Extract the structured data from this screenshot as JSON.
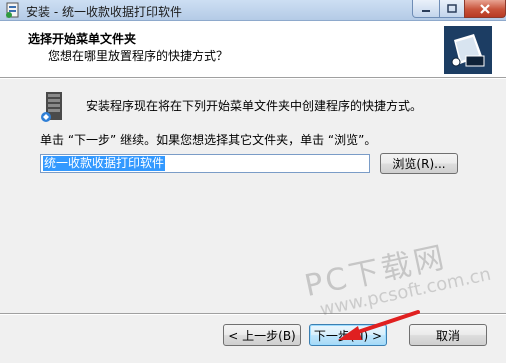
{
  "window": {
    "title": "安装 - 统一收款收据打印软件",
    "controls": {
      "minimize_icon": "minimize-icon",
      "maximize_icon": "maximize-icon",
      "close_icon": "close-icon"
    }
  },
  "header": {
    "title": "选择开始菜单文件夹",
    "subtitle": "您想在哪里放置程序的快捷方式？"
  },
  "body": {
    "intro": "安装程序现在将在下列开始菜单文件夹中创建程序的快捷方式。",
    "hint": "单击 “下一步” 继续。如果您想选择其它文件夹，单击 “浏览”。",
    "folder_value": "统一收款收据打印软件",
    "browse_label": "浏览(R)..."
  },
  "footer": {
    "back_label": "< 上一步(B)",
    "next_label": "下一步(N) >",
    "cancel_label": "取消"
  },
  "watermark": {
    "brand": "PC下载网",
    "url": "www.pcsoft.com.cn"
  },
  "colors": {
    "selection": "#3399ff",
    "arrow": "#e02020",
    "close_button": "#c8533a"
  }
}
